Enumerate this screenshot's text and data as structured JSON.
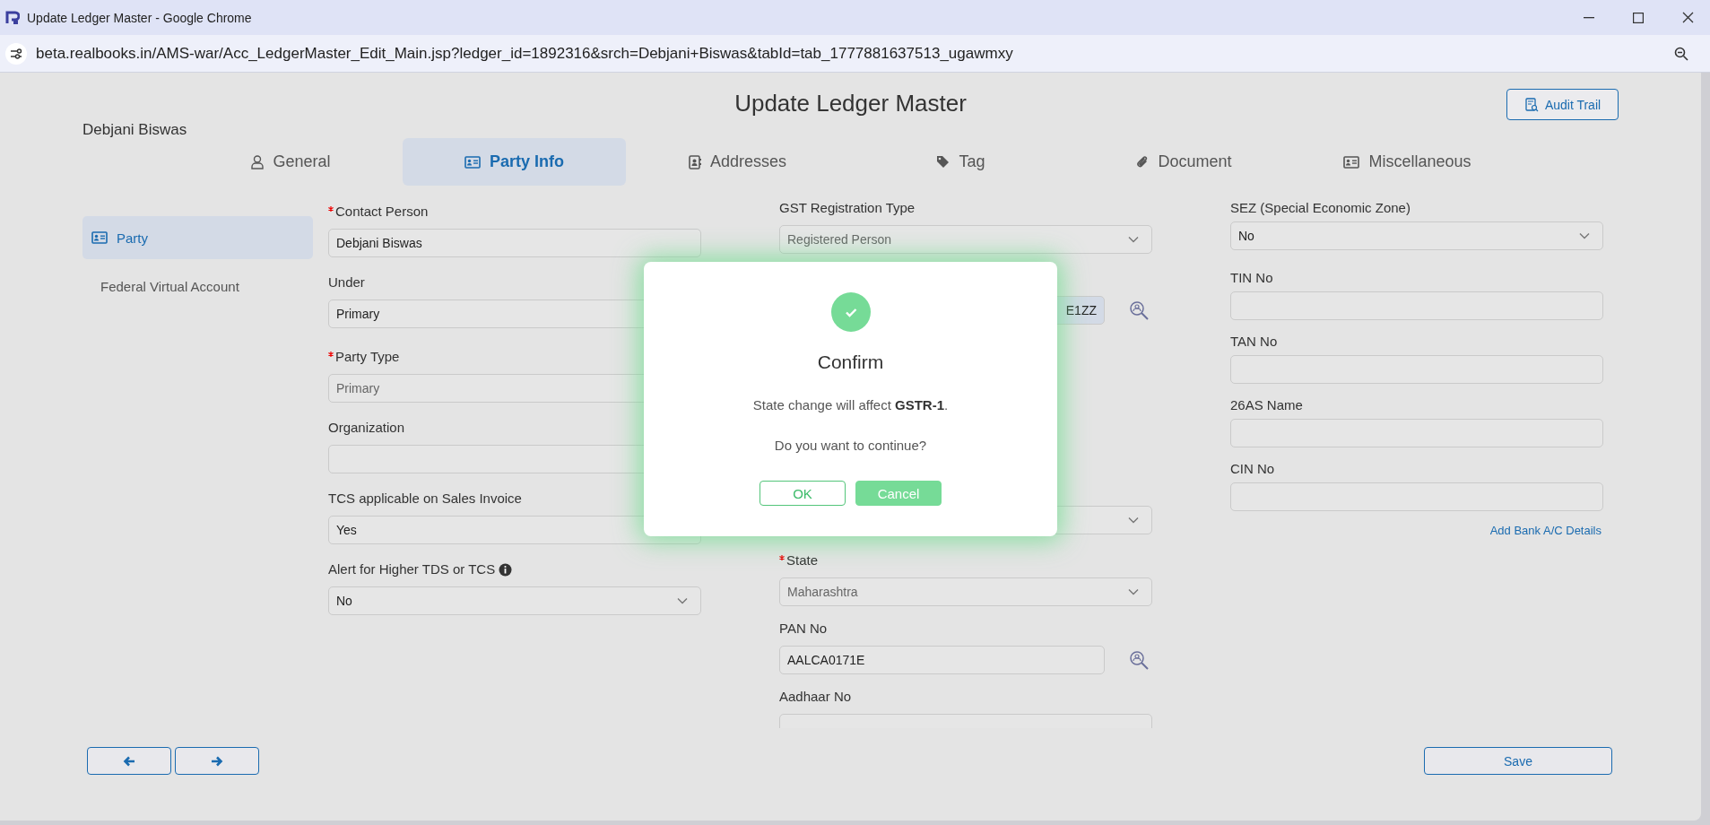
{
  "window": {
    "title": "Update Ledger Master - Google Chrome",
    "url": "beta.realbooks.in/AMS-war/Acc_LedgerMaster_Edit_Main.jsp?ledger_id=1892316&srch=Debjani+Biswas&tabId=tab_1777881637513_ugawmxy"
  },
  "page": {
    "title": "Update Ledger Master",
    "ledger_name": "Debjani Biswas",
    "audit_button": "Audit Trail"
  },
  "tabs": [
    {
      "label": "General",
      "selected": false
    },
    {
      "label": "Party Info",
      "selected": true
    },
    {
      "label": "Addresses",
      "selected": false
    },
    {
      "label": "Tag",
      "selected": false
    },
    {
      "label": "Document",
      "selected": false
    },
    {
      "label": "Miscellaneous",
      "selected": false
    }
  ],
  "sidebar": {
    "items": [
      {
        "label": "Party",
        "selected": true
      },
      {
        "label": "Federal Virtual Account",
        "selected": false
      }
    ]
  },
  "columns": [
    [
      {
        "kind": "text",
        "label": "Contact Person",
        "required": true,
        "value": "Debjani Biswas"
      },
      {
        "kind": "text",
        "label": "Under",
        "value": "Primary"
      },
      {
        "kind": "text",
        "label": "Party Type",
        "required": true,
        "value": "Primary",
        "disabled": true
      },
      {
        "kind": "text",
        "label": "Organization"
      },
      {
        "kind": "text",
        "label": "TCS applicable on Sales Invoice",
        "value": "Yes"
      },
      {
        "kind": "select",
        "label": "Alert for Higher TDS or TCS",
        "info": true,
        "value": "No"
      }
    ],
    [
      {
        "kind": "select",
        "label": "GST Registration Type",
        "value": "Registered Person",
        "disabled": true
      },
      {
        "kind": "text",
        "value": "E1ZZ",
        "highlighted": true,
        "lookup": true
      },
      {
        "kind": "covered"
      },
      {
        "kind": "covered"
      },
      {
        "kind": "select"
      },
      {
        "kind": "select",
        "label": "State",
        "required": true,
        "value": "Maharashtra",
        "disabled": true
      },
      {
        "kind": "text",
        "label": "PAN No",
        "value": "AALCA0171E",
        "lookup": true
      },
      {
        "kind": "text",
        "label": "Aadhaar No"
      }
    ],
    [
      {
        "kind": "select",
        "label": "SEZ (Special Economic Zone)",
        "value": "No"
      },
      {
        "kind": "text",
        "label": "TIN No"
      },
      {
        "kind": "text",
        "label": "TAN No"
      },
      {
        "kind": "text",
        "label": "26AS Name"
      },
      {
        "kind": "text",
        "label": "CIN No"
      }
    ]
  ],
  "add_bank_link": "Add Bank A/C Details",
  "save_button": "Save",
  "dialog": {
    "title": "Confirm",
    "message": "State change will affect **GSTR-1**.",
    "question": "Do you want to continue?",
    "buttons": [
      {
        "label": "OK",
        "kind": "outline"
      },
      {
        "label": "Cancel",
        "kind": "filled"
      }
    ]
  }
}
